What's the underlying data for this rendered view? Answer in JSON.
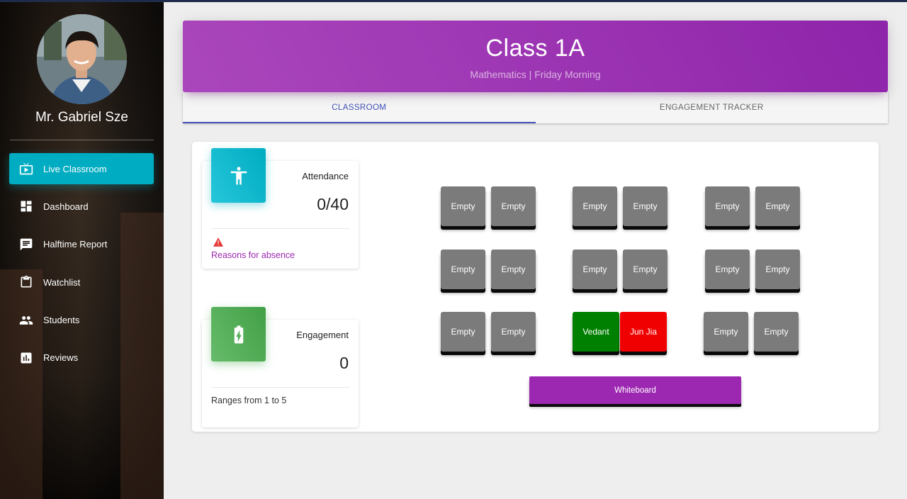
{
  "sidebar": {
    "teacher_name": "Mr. Gabriel Sze",
    "items": [
      {
        "label": "Live Classroom",
        "icon": "live-tv-icon",
        "active": true
      },
      {
        "label": "Dashboard",
        "icon": "dashboard-icon"
      },
      {
        "label": "Halftime Report",
        "icon": "feedback-icon"
      },
      {
        "label": "Watchlist",
        "icon": "clipboard-icon"
      },
      {
        "label": "Students",
        "icon": "people-icon"
      },
      {
        "label": "Reviews",
        "icon": "bar-chart-icon"
      }
    ]
  },
  "header": {
    "title": "Class 1A",
    "subtitle": "Mathematics | Friday Morning"
  },
  "tabs": [
    "CLASSROOM",
    "ENGAGEMENT TRACKER"
  ],
  "attendance": {
    "label": "Attendance",
    "value": "0/40",
    "link": "Reasons for absence",
    "icon": "accessibility-icon",
    "warning_icon": "warning-icon"
  },
  "engagement": {
    "label": "Engagement",
    "value": "0",
    "footer": "Ranges from 1 to 5",
    "icon": "battery-charging-icon"
  },
  "seats": [
    "Empty",
    "Empty",
    "Empty",
    "Empty",
    "Empty",
    "Empty",
    "Empty",
    "Empty",
    "Empty",
    "Empty",
    "Empty",
    "Empty",
    "Empty",
    "Empty",
    "Vedant",
    "Jun Jia",
    "Empty",
    "Empty"
  ],
  "whiteboard": "Whiteboard",
  "colors": {
    "accent_purple": "#9c27b0",
    "active_nav": "#00acc1",
    "seat_empty": "#7b7b7b",
    "seat_engaged": "#008000",
    "seat_alert": "#f00000"
  }
}
